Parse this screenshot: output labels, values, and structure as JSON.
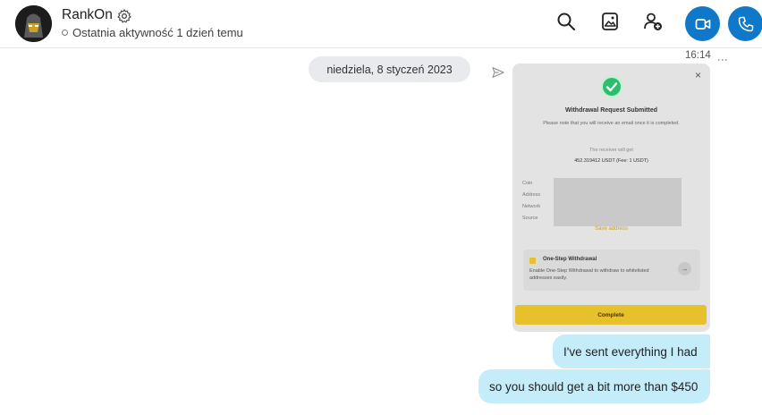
{
  "header": {
    "contact_name": "RankOn",
    "status": "Ostatnia aktywność 1 dzień temu",
    "icons": [
      "settings-gear-icon",
      "search-icon",
      "gallery-icon",
      "add-person-icon",
      "video-call-icon",
      "phone-call-icon"
    ],
    "accent_color": "#0f78c9"
  },
  "conversation": {
    "timestamp": "16:14",
    "date_divider": "niedziela, 8 styczeń 2023",
    "attachment": {
      "title": "Withdrawal Request Submitted",
      "note": "Please note that you will receive an email once it is completed.",
      "receiver_label": "The receiver will get",
      "amount": "452.319412 USDT  (Fee: 1 USDT)",
      "fields": [
        "Coin",
        "Address",
        "Network",
        "Source"
      ],
      "save_address": "Save address",
      "box_title": "One-Step Withdrawal",
      "box_text": "Enable One-Step Withdrawal to withdraw to whitelisted addresses easily.",
      "complete_label": "Complete",
      "close_symbol": "×"
    },
    "messages": [
      {
        "text": "I've sent everything I had"
      },
      {
        "text": "so you should get a bit more than $450"
      }
    ],
    "bubble_color": "#c4ecf9"
  }
}
